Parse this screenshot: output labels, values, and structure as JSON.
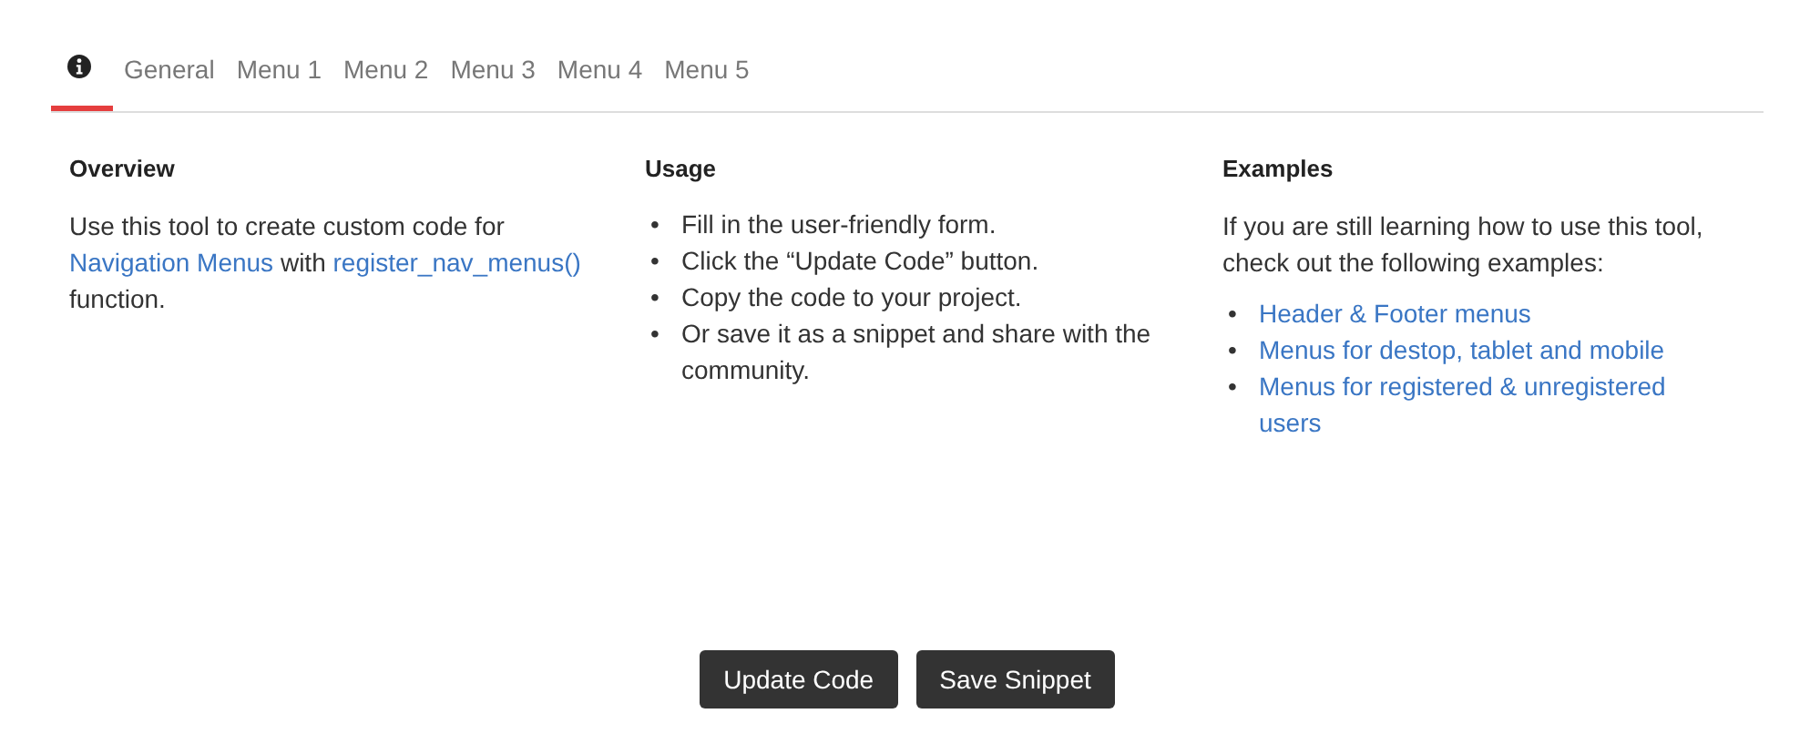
{
  "tabs": [
    {
      "kind": "icon",
      "selected": true
    },
    {
      "kind": "text",
      "label": "General",
      "selected": false
    },
    {
      "kind": "text",
      "label": "Menu 1",
      "selected": false
    },
    {
      "kind": "text",
      "label": "Menu 2",
      "selected": false
    },
    {
      "kind": "text",
      "label": "Menu 3",
      "selected": false
    },
    {
      "kind": "text",
      "label": "Menu 4",
      "selected": false
    },
    {
      "kind": "text",
      "label": "Menu 5",
      "selected": false
    }
  ],
  "overview": {
    "heading": "Overview",
    "paragraph": [
      {
        "text": "Use this tool to create custom code for ",
        "link": false
      },
      {
        "text": "Navigation Menus",
        "link": true
      },
      {
        "text": " with ",
        "link": false
      },
      {
        "text": "register_nav_menus()",
        "link": true
      },
      {
        "text": " function.",
        "link": false
      }
    ]
  },
  "usage": {
    "heading": "Usage",
    "bullet": "•",
    "items": [
      "Fill in the user-friendly form.",
      "Click the “Update Code” button.",
      "Copy the code to your project.",
      "Or save it as a snippet and share with the community."
    ]
  },
  "examples": {
    "heading": "Examples",
    "intro": "If you are still learning how to use this tool, check out the following examples:",
    "bullet": "•",
    "links": [
      "Header & Footer menus",
      "Menus for destop, tablet and mobile",
      "Menus for registered & unregistered users"
    ]
  },
  "buttons": [
    "Update Code",
    "Save Snippet"
  ]
}
